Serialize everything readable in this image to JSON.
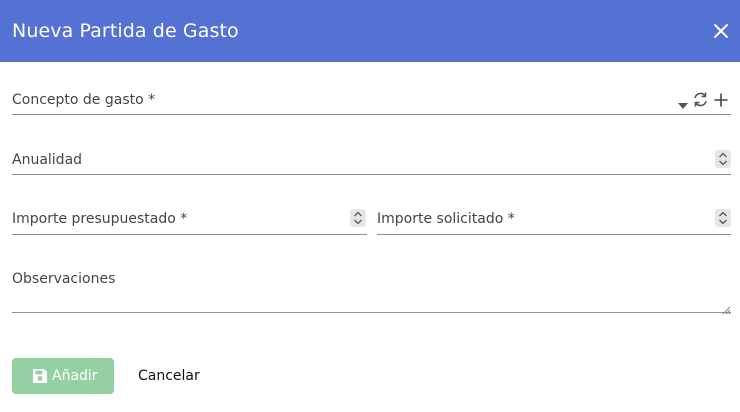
{
  "dialog": {
    "title": "Nueva Partida de Gasto",
    "accent_color": "#5472d3"
  },
  "fields": {
    "concepto": {
      "label": "Concepto de gasto *",
      "value": ""
    },
    "anualidad": {
      "label": "Anualidad",
      "value": ""
    },
    "importe_presupuestado": {
      "label": "Importe presupuestado *",
      "value": ""
    },
    "importe_solicitado": {
      "label": "Importe solicitado *",
      "value": ""
    },
    "observaciones": {
      "label": "Observaciones",
      "value": ""
    }
  },
  "icons": {
    "close": "close-icon",
    "dropdown": "caret-down-icon",
    "refresh": "refresh-icon",
    "add": "plus-icon",
    "save": "floppy-disk-icon"
  },
  "actions": {
    "add_label": "Añadir",
    "cancel_label": "Cancelar",
    "add_color": "#95d0a2"
  }
}
